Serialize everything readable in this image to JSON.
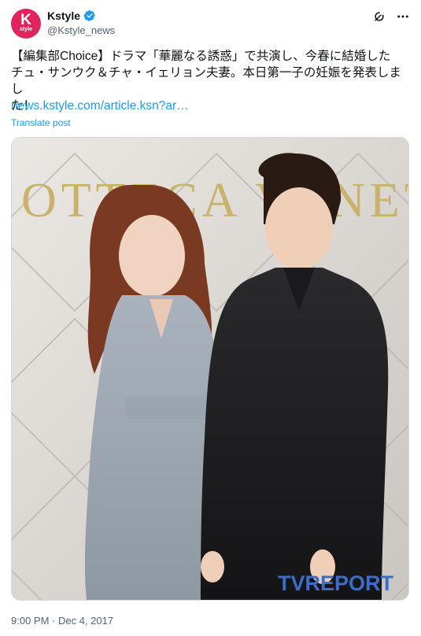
{
  "account": {
    "name": "Kstyle",
    "handle": "@Kstyle_news",
    "avatar_letter": "K",
    "avatar_sub": "style",
    "avatar_color": "#e0245e"
  },
  "tweet": {
    "text": "【編集部Choice】ドラマ「華麗なる誘惑」で共演し、今春に結婚した\nチュ・サンウク＆チャ・イェリョン夫妻。本日第一子の妊娠を発表しまし\nた！",
    "link_text": "news.kstyle.com/article.ksn?ar…",
    "translate_label": "Translate post",
    "timestamp": "9:00 PM · Dec 4, 2017"
  },
  "photo": {
    "background_sign": "OTTECA VENET",
    "watermark": "TVREPORT",
    "description_icon": "photo-icon"
  },
  "icons": {
    "verified": "verified-badge-icon",
    "grok": "grok-icon",
    "more": "more-icon"
  },
  "colors": {
    "link": "#1d9bf0",
    "secondary": "#536471"
  }
}
